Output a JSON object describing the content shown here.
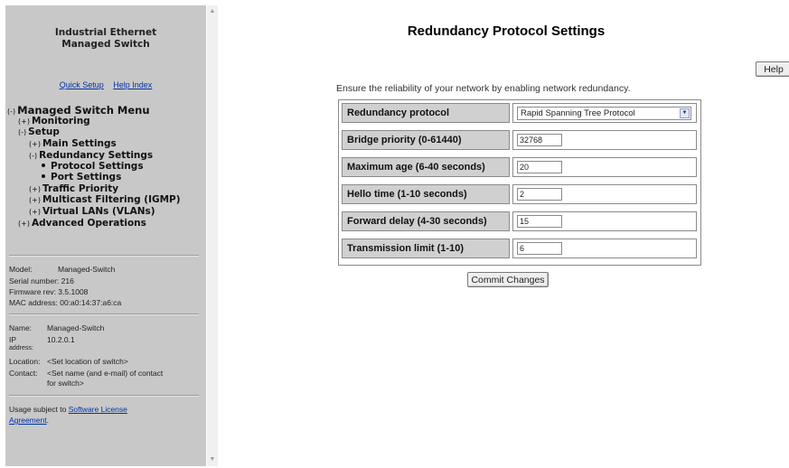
{
  "sidebar": {
    "brand_line1": "Industrial Ethernet",
    "brand_line2": "Managed Switch",
    "quick_setup": "Quick Setup",
    "help_index": "Help Index",
    "tree": {
      "managed_switch_menu": {
        "toggle": "(-)",
        "label": "Managed Switch Menu"
      },
      "monitoring": {
        "toggle": "(+)",
        "label": "Monitoring"
      },
      "setup": {
        "toggle": "(-)",
        "label": "Setup"
      },
      "main_settings": {
        "toggle": "(+)",
        "label": "Main Settings"
      },
      "redundancy_settings": {
        "toggle": "(-)",
        "label": "Redundancy Settings"
      },
      "protocol_settings": {
        "label": "Protocol Settings"
      },
      "port_settings": {
        "label": "Port Settings"
      },
      "traffic_priority": {
        "toggle": "(+)",
        "label": "Traffic Priority"
      },
      "multicast_filtering": {
        "toggle": "(+)",
        "label": "Multicast Filtering (IGMP)"
      },
      "virtual_lans": {
        "toggle": "(+)",
        "label": "Virtual LANs (VLANs)"
      },
      "advanced_operations": {
        "toggle": "(+)",
        "label": "Advanced Operations"
      }
    },
    "device": {
      "model_label": "Model:",
      "model_value": "Managed-Switch",
      "serial": "Serial number: 216",
      "firmware": "Firmware rev: 3.5.1008",
      "mac": "MAC address: 00:a0:14:37:a6:ca"
    },
    "identity": {
      "name_label": "Name:",
      "name_value": "Managed-Switch",
      "ip_label": "IP",
      "ip_value": "10.2.0.1",
      "ip_label2": "address:",
      "location_label": "Location:",
      "location_value": "<Set location of switch>",
      "contact_label": "Contact:",
      "contact_value1": "<Set name (and e-mail) of contact",
      "contact_value2": "for switch>"
    },
    "license": {
      "prefix": "Usage subject to ",
      "link1": "Software License",
      "link2": "Agreement",
      "suffix": "."
    }
  },
  "main": {
    "title": "Redundancy Protocol Settings",
    "help_label": "Help",
    "intro": "Ensure the reliability of your network by enabling network redundancy.",
    "rows": [
      {
        "label": "Redundancy protocol",
        "value": "Rapid Spanning Tree Protocol"
      },
      {
        "label": "Bridge priority (0-61440)",
        "value": "32768"
      },
      {
        "label": "Maximum age (6-40 seconds)",
        "value": "20"
      },
      {
        "label": "Hello time (1-10 seconds)",
        "value": "2"
      },
      {
        "label": "Forward delay (4-30 seconds)",
        "value": "15"
      },
      {
        "label": "Transmission limit (1-10)",
        "value": "6"
      }
    ],
    "commit_label": "Commit Changes"
  }
}
